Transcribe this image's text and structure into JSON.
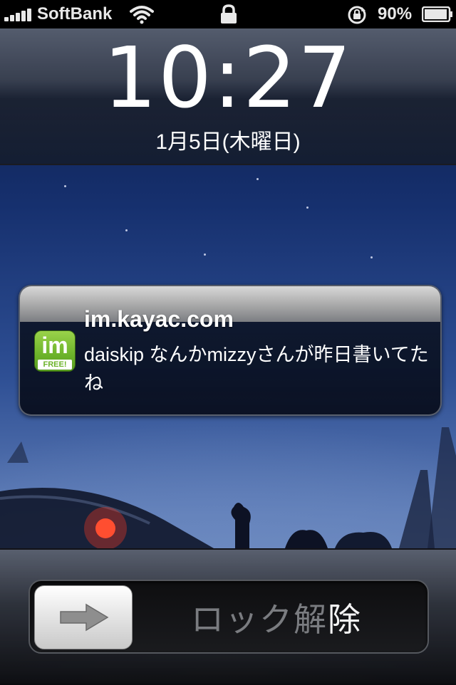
{
  "status_bar": {
    "carrier": "SoftBank",
    "battery_percent": "90%",
    "signal_bars": 5,
    "icons": [
      "signal-icon",
      "wifi-icon",
      "lock-icon",
      "rotation-lock-icon",
      "battery-icon"
    ]
  },
  "lock_screen": {
    "time": "10:27",
    "date": "1月5日(木曜日)"
  },
  "notification": {
    "app_icon": "im-app-icon",
    "app_icon_text": "im",
    "app_icon_badge": "FREE!",
    "title": "im.kayac.com",
    "message": "daiskip なんかmizzyさんが昨日書いてたね"
  },
  "unlock_slider": {
    "label_dim": "ロック解",
    "label_bright": "除",
    "icon": "right-arrow-icon"
  }
}
